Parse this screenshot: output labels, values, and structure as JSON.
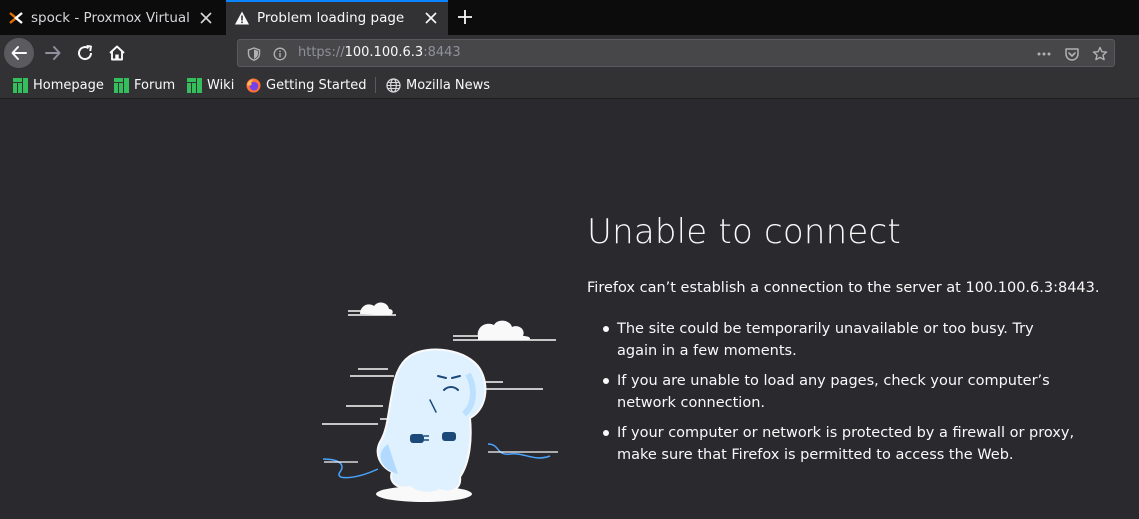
{
  "tabs": [
    {
      "title": "spock - Proxmox Virtual Environment",
      "icon": "proxmox-icon",
      "active": false
    },
    {
      "title": "Problem loading page",
      "icon": "warning-icon",
      "active": true
    }
  ],
  "toolbar": {
    "url_scheme": "https://",
    "url_host": "100.100.6.3",
    "url_port": ":8443"
  },
  "bookmarks": [
    {
      "label": "Homepage",
      "icon": "manjaro-icon"
    },
    {
      "label": "Forum",
      "icon": "manjaro-icon"
    },
    {
      "label": "Wiki",
      "icon": "manjaro-icon"
    },
    {
      "label": "Getting Started",
      "icon": "firefox-icon"
    },
    {
      "label": "Mozilla News",
      "icon": "globe-icon"
    }
  ],
  "error": {
    "title": "Unable to connect",
    "description": "Firefox can’t establish a connection to the server at 100.100.6.3:8443.",
    "bullets": [
      "The site could be temporarily unavailable or too busy. Try again in a few moments.",
      "If you are unable to load any pages, check your computer’s network connection.",
      "If your computer or network is protected by a firewall or proxy, make sure that Firefox is permitted to access the Web."
    ]
  },
  "colors": {
    "accent": "#0a84ff",
    "proxmox_orange": "#e57000",
    "manjaro_green": "#35bf5c",
    "page_bg": "#2a2a2e"
  }
}
